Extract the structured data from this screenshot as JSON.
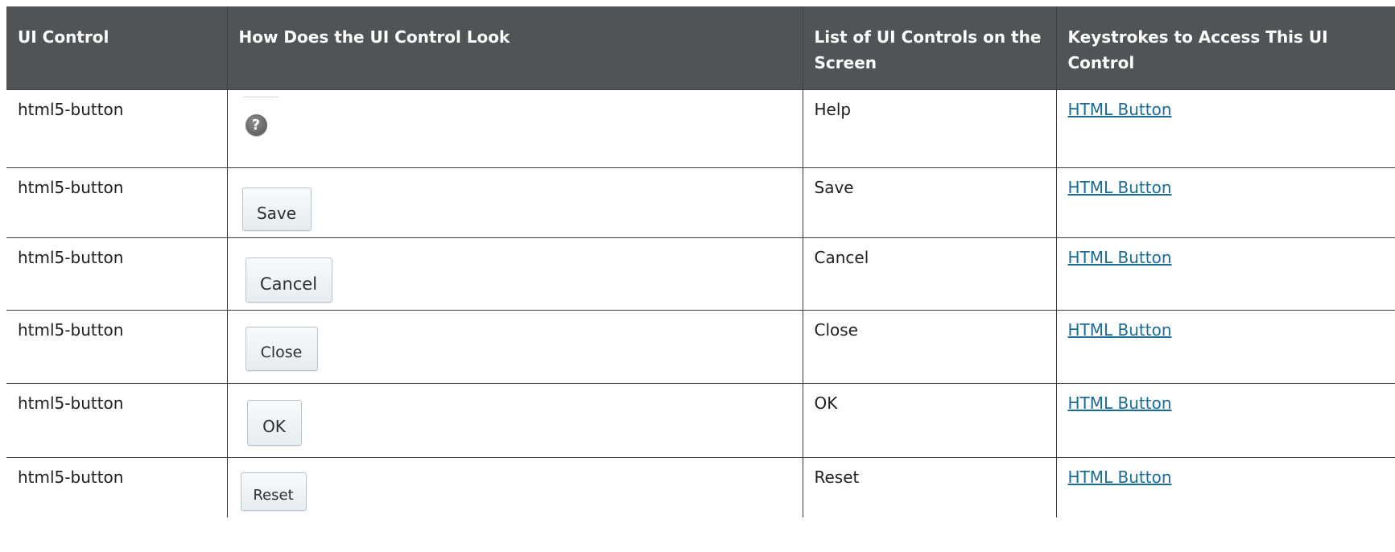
{
  "table": {
    "headers": [
      "UI Control",
      "How Does the UI Control Look",
      "List of UI Controls on the Screen",
      "Keystrokes to Access This UI Control"
    ],
    "rows": [
      {
        "control": "html5-button",
        "look_icon": "help-icon",
        "look_glyph": "?",
        "name": "Help",
        "keystrokes": "HTML Button"
      },
      {
        "control": "html5-button",
        "look_button_label": "Save",
        "name": "Save",
        "keystrokes": "HTML Button"
      },
      {
        "control": "html5-button",
        "look_button_label": "Cancel",
        "name": "Cancel",
        "keystrokes": "HTML Button"
      },
      {
        "control": "html5-button",
        "look_button_label": "Close",
        "name": "Close",
        "keystrokes": "HTML Button"
      },
      {
        "control": "html5-button",
        "look_button_label": "OK",
        "name": "OK",
        "keystrokes": "HTML Button"
      },
      {
        "control": "html5-button",
        "look_button_label": "Reset",
        "name": "Reset",
        "keystrokes": "HTML Button"
      }
    ]
  },
  "colors": {
    "header_bg": "#525355",
    "header_text": "#ffffff",
    "link": "#1b6b97",
    "body_text": "#1f1f1f"
  }
}
